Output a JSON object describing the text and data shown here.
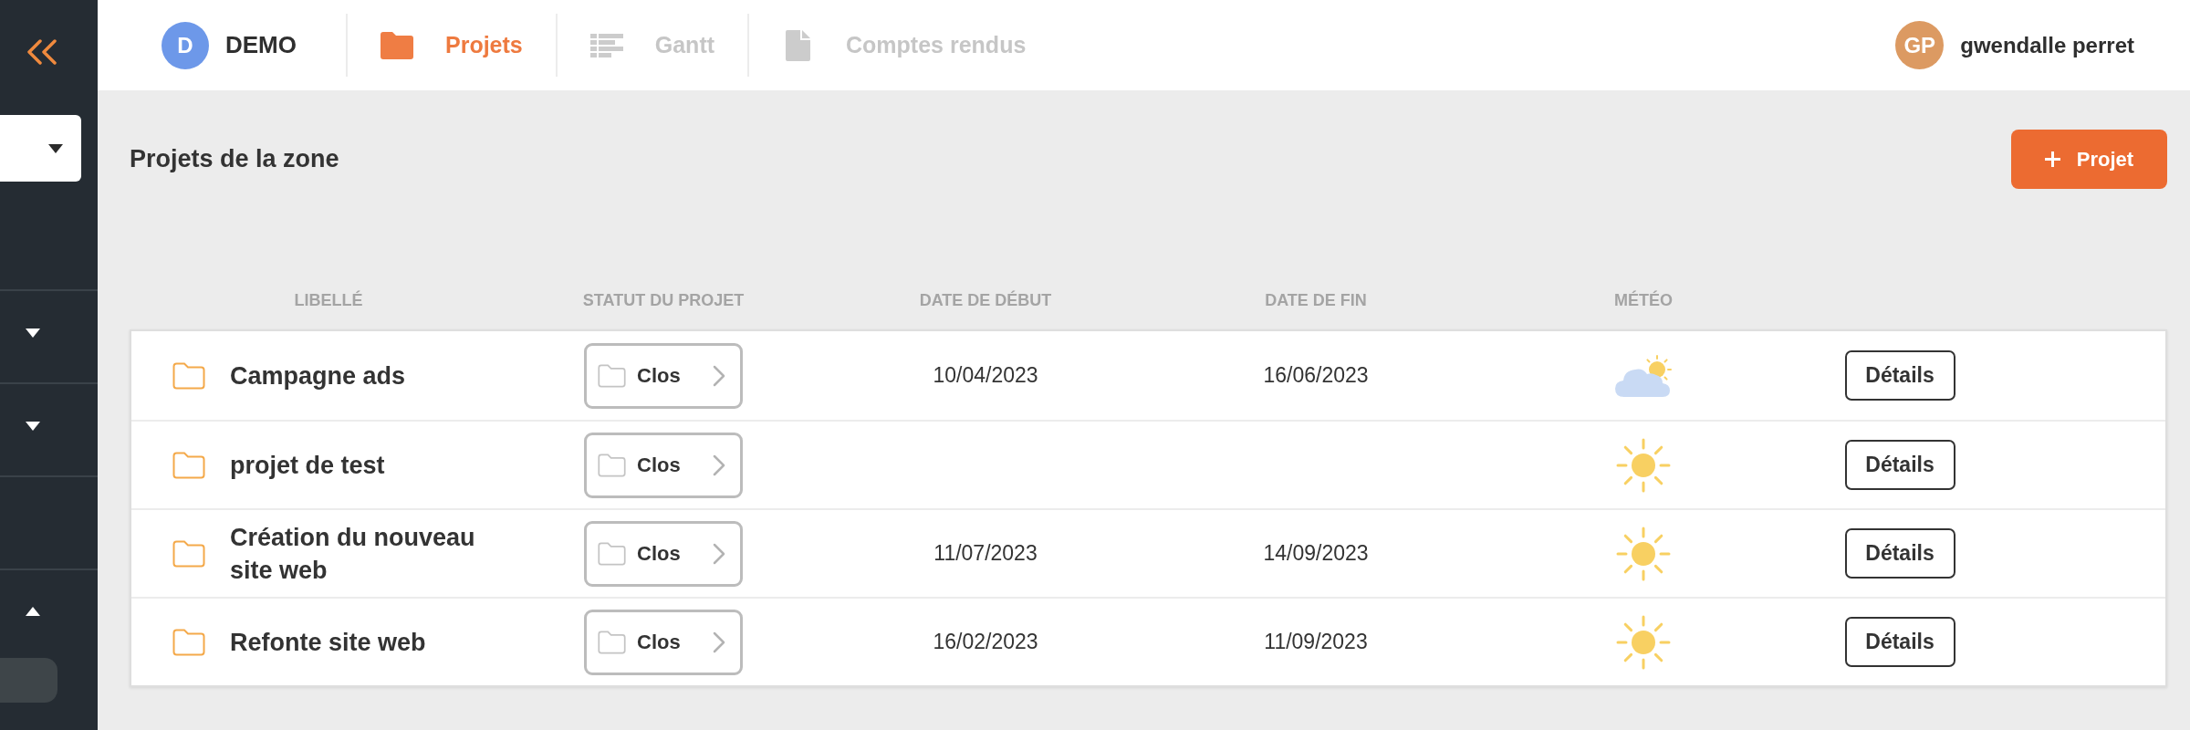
{
  "sidebar": {
    "dropdown": {
      "expanded": false
    },
    "sections": [
      {
        "kind": "collapsible",
        "expanded": false
      },
      {
        "kind": "collapsible",
        "expanded": false
      },
      {
        "kind": "plain"
      },
      {
        "kind": "collapsible",
        "expanded": true,
        "items": [
          {
            "selected": true
          }
        ]
      }
    ]
  },
  "topbar": {
    "workspace": {
      "initial": "D",
      "name": "DEMO"
    },
    "tabs": [
      {
        "kind": "projects",
        "label": "Projets",
        "selected": true
      },
      {
        "kind": "gantt",
        "label": "Gantt",
        "selected": false
      },
      {
        "kind": "reports",
        "label": "Comptes rendus",
        "selected": false
      }
    ],
    "user": {
      "initials": "GP",
      "name": "gwendalle perret"
    }
  },
  "page": {
    "title": "Projets de la zone",
    "new_button": {
      "label": "Projet"
    }
  },
  "table": {
    "columns": [
      "LIBELLÉ",
      "STATUT DU PROJET",
      "DATE DE DÉBUT",
      "DATE DE FIN",
      "MÉTÉO"
    ],
    "rows": [
      {
        "label": "Campagne ads",
        "status": "Clos",
        "start": "10/04/2023",
        "end": "16/06/2023",
        "weather": {
          "kind": "cloudy"
        },
        "action": "Détails"
      },
      {
        "label": "projet de test",
        "status": "Clos",
        "weather": {
          "kind": "sunny"
        },
        "action": "Détails"
      },
      {
        "label": "Création du nouveau site web",
        "status": "Clos",
        "start": "11/07/2023",
        "end": "14/09/2023",
        "weather": {
          "kind": "sunny"
        },
        "action": "Détails"
      },
      {
        "label": "Refonte site web",
        "status": "Clos",
        "start": "16/02/2023",
        "end": "11/09/2023",
        "weather": {
          "kind": "sunny"
        },
        "action": "Détails"
      }
    ]
  }
}
